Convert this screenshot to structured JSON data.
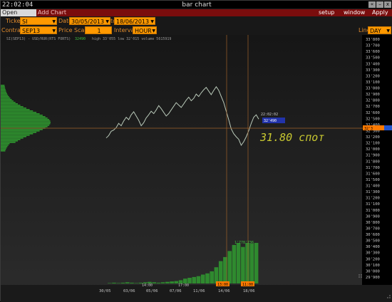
{
  "window": {
    "clock": "22:02:04",
    "title": "bar chart",
    "btn_back": "«",
    "btn_min": "–",
    "btn_close": "x"
  },
  "tabs": {
    "open_interest": "Open Interest",
    "add_chart": "Add Chart"
  },
  "menu": {
    "setup": "setup",
    "window": "window",
    "apply": "Apply"
  },
  "toolbar": {
    "ticker_label": "Ticker",
    "ticker_value": "SI",
    "date_label": "Date",
    "date_from": "30/05/2013",
    "date_to_label": "to",
    "date_to": "18/06/2013",
    "contract_label": "Contract",
    "contract_value": "SEP13",
    "price_scale_label": "Price Scale",
    "price_scale_value": "1",
    "interval_label": "Interval",
    "interval_value": "HOUR",
    "line_label": "Line",
    "line_value": "DAY"
  },
  "chart_info": {
    "symbol": "SI(SEP13) - USD/RUR(RTS FORTS)",
    "last": "32490",
    "stats": "high 33'055  low 32'015  volume 5615919"
  },
  "annotations": {
    "time_label": "22:02:02",
    "price_label": "32'490",
    "price_axis_tag": "32'3",
    "handwritten_note": "31.80 спот",
    "volume_label": "1'778'736"
  },
  "x_axis": {
    "date_labels": [
      "30/05",
      "03/06",
      "05/06",
      "07/06",
      "11/06",
      "14/06",
      "18/06"
    ],
    "time_labels": [
      "14:00",
      "17:00"
    ],
    "highlight_labels": [
      "13:00",
      "11:00"
    ]
  },
  "chart_data": {
    "type": "line",
    "y_axis_labels": [
      "33'800",
      "33'700",
      "33'600",
      "33'500",
      "33'400",
      "33'300",
      "33'200",
      "33'100",
      "33'000",
      "32'900",
      "32'800",
      "32'700",
      "32'600",
      "32'500",
      "32'400",
      "32'300",
      "32'200",
      "32'100",
      "32'000",
      "31'900",
      "31'800",
      "31'700",
      "31'600",
      "31'500",
      "31'400",
      "31'300",
      "31'200",
      "31'100",
      "31'000",
      "30'900",
      "30'800",
      "30'700",
      "30'600",
      "30'500",
      "30'400",
      "30'300",
      "30'200",
      "30'100",
      "30'000",
      "29'900"
    ],
    "ylim": [
      29900,
      33800
    ],
    "price_series": [
      32180,
      32220,
      32290,
      32310,
      32350,
      32420,
      32380,
      32460,
      32520,
      32480,
      32560,
      32610,
      32540,
      32470,
      32380,
      32430,
      32510,
      32560,
      32620,
      32580,
      32640,
      32710,
      32660,
      32600,
      32540,
      32580,
      32640,
      32700,
      32760,
      32720,
      32680,
      32740,
      32800,
      32850,
      32790,
      32830,
      32900,
      32860,
      32920,
      32970,
      33010,
      32950,
      32890,
      32960,
      33020,
      32960,
      32860,
      32760,
      32620,
      32480,
      32330,
      32250,
      32200,
      32160,
      32060,
      32120,
      32200,
      32300,
      32420,
      32520,
      32560,
      32490
    ],
    "volume_series": [
      1,
      2,
      1,
      2,
      3,
      2,
      1,
      2,
      3,
      4,
      3,
      2,
      3,
      4,
      5,
      6,
      8,
      12,
      14,
      16,
      18,
      22,
      25,
      30,
      40,
      55,
      65,
      80,
      95,
      100,
      90,
      100,
      98,
      100
    ]
  }
}
